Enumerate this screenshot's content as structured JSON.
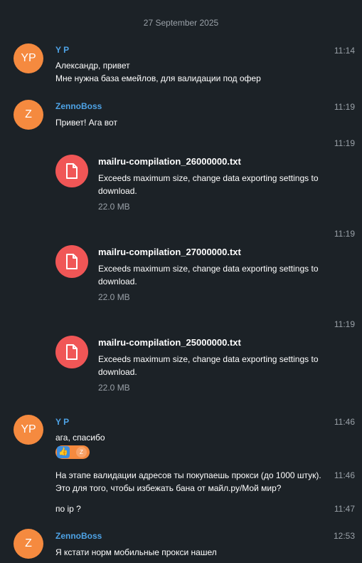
{
  "date_separator": "27 September 2025",
  "messages": [
    {
      "avatar": "YP",
      "author": "Y P",
      "time": "11:14",
      "text": "Александр, привет\nМне нужна база емейлов, для валидации под офер"
    },
    {
      "avatar": "Z",
      "author": "ZennoBoss",
      "time": "11:19",
      "text": "Привет! Ага вот"
    }
  ],
  "files": [
    {
      "time": "11:19",
      "name": "mailru-compilation_26000000.txt",
      "description": "Exceeds maximum size, change data exporting settings to download.",
      "size": "22.0 MB",
      "icon": "file-icon"
    },
    {
      "time": "11:19",
      "name": "mailru-compilation_27000000.txt",
      "description": "Exceeds maximum size, change data exporting settings to download.",
      "size": "22.0 MB",
      "icon": "file-icon"
    },
    {
      "time": "11:19",
      "name": "mailru-compilation_25000000.txt",
      "description": "Exceeds maximum size, change data exporting settings to download.",
      "size": "22.0 MB",
      "icon": "file-icon"
    }
  ],
  "messages2": [
    {
      "avatar": "YP",
      "author": "Y P",
      "time": "11:46",
      "text": "ага, спасибо"
    },
    {
      "time": "11:46",
      "text": "На этапе валидации адресов ты покупаешь прокси (до 1000 штук).\nЭто для того, чтобы избежать бана от майл.ру/Мой мир?"
    },
    {
      "time": "11:47",
      "text": "по ip ?"
    },
    {
      "avatar": "Z",
      "author": "ZennoBoss",
      "time": "12:53",
      "text": "Я кстати норм мобильные прокси нашел"
    }
  ],
  "reaction": {
    "emoji": "👍",
    "user_initial": "Z"
  },
  "colors": {
    "background": "#1c2227",
    "avatar": "#f58a3f",
    "author": "#4ea3e6",
    "file_icon": "#f05656",
    "muted": "#9aa1a8"
  }
}
